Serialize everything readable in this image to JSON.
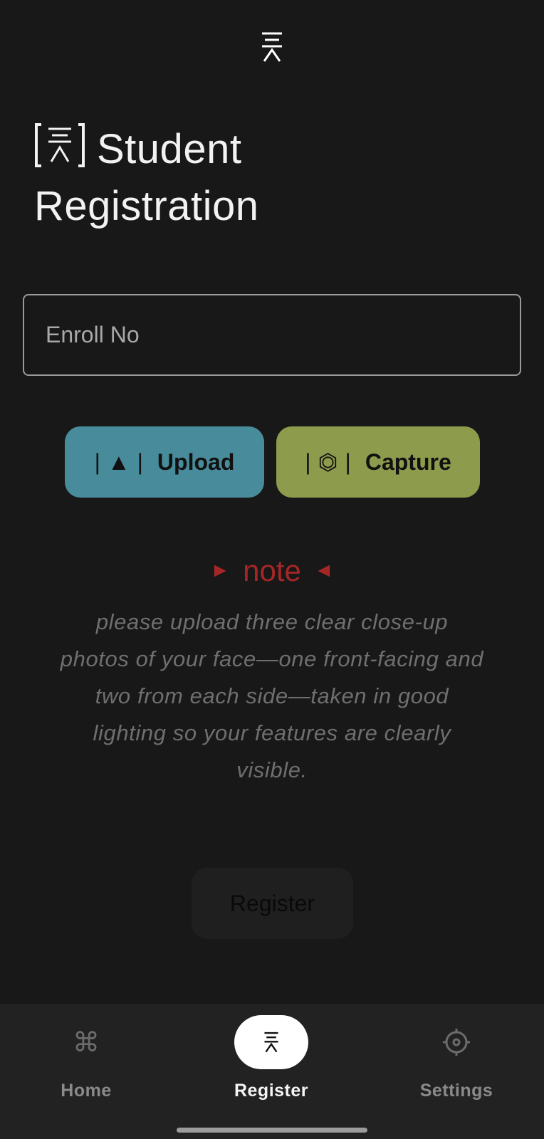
{
  "app": {
    "title_line1": "Student",
    "title_line2": "Registration",
    "logo_icon": "tsa-logo-icon"
  },
  "form": {
    "enroll_placeholder": "Enroll No",
    "enroll_value": ""
  },
  "actions": {
    "upload_label": "Upload",
    "upload_glyph": "▲",
    "capture_label": "Capture",
    "capture_glyph": "⏣",
    "upload_color": "#488b9a",
    "capture_color": "#8d9b4c"
  },
  "note": {
    "left_arrow": "►",
    "label": "note",
    "right_arrow": "◄",
    "text": "please upload three clear close-up photos of your face—one front-facing and two from each side—taken in good lighting so your features are clearly visible.",
    "color": "#a52626"
  },
  "register": {
    "label": "Register"
  },
  "bottom_nav": {
    "items": [
      {
        "label": "Home",
        "icon": "command-icon",
        "glyph": "⌘",
        "active": false
      },
      {
        "label": "Register",
        "icon": "tsa-logo-icon",
        "glyph": "",
        "active": true
      },
      {
        "label": "Settings",
        "icon": "gear-icon",
        "glyph": "",
        "active": false
      }
    ]
  }
}
